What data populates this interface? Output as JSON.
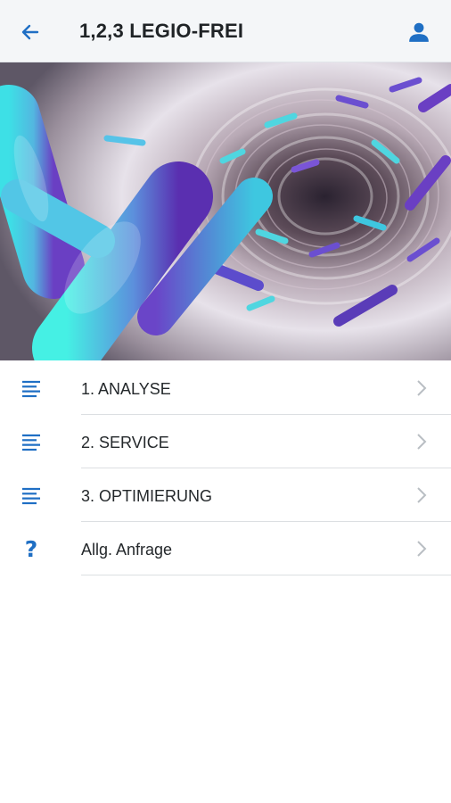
{
  "header": {
    "title": "1,2,3 LEGIO-FREI",
    "back_icon": "arrow-left-icon",
    "profile_icon": "user-icon"
  },
  "hero": {
    "image_subject": "legionella-bacteria-in-pipe-illustration"
  },
  "menu": {
    "items": [
      {
        "label": "1. ANALYSE",
        "icon": "list-icon"
      },
      {
        "label": "2. SERVICE",
        "icon": "list-icon"
      },
      {
        "label": "3. OPTIMIERUNG",
        "icon": "list-icon"
      },
      {
        "label": "Allg. Anfrage",
        "icon": "question-icon"
      }
    ]
  },
  "colors": {
    "accent": "#1f6fc4",
    "header_bg": "#f4f6f8",
    "chevron": "#b9bec3"
  }
}
